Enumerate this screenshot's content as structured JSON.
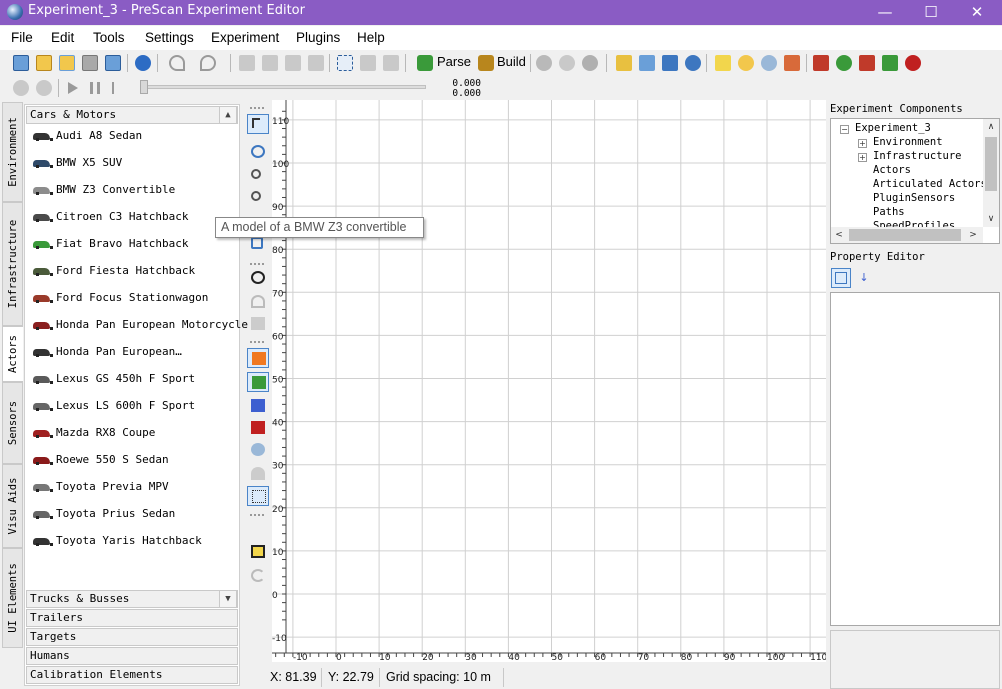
{
  "window": {
    "title": "Experiment_3 - PreScan Experiment Editor",
    "controls": {
      "minimize": "—",
      "maximize": "☐",
      "close": "✕"
    }
  },
  "menu": [
    "File",
    "Edit",
    "Tools",
    "Settings",
    "Experiment",
    "Plugins",
    "Help"
  ],
  "toolbar": {
    "parse_label": "Parse",
    "build_label": "Build"
  },
  "sim_readout": {
    "top": "0.000",
    "bottom": "0.000"
  },
  "side_tabs": [
    "Environment",
    "Infrastructure",
    "Actors",
    "Sensors",
    "Visu Aids",
    "UI Elements"
  ],
  "palette": {
    "expanded_category": "Cars & Motors",
    "items": [
      "Audi A8 Sedan",
      "BMW X5 SUV",
      "BMW Z3 Convertible",
      "Citroen C3 Hatchback",
      "Fiat Bravo Hatchback",
      "Ford Fiesta Hatchback",
      "Ford Focus Stationwagon",
      "Honda Pan European Motorcycle",
      "Honda Pan European…",
      "Lexus GS 450h F Sport",
      "Lexus LS 600h F Sport",
      "Mazda RX8 Coupe",
      "Roewe 550 S Sedan",
      "Toyota Previa MPV",
      "Toyota Prius Sedan",
      "Toyota Yaris Hatchback"
    ],
    "item_colors": [
      "#333333",
      "#2f4a6a",
      "#8c8c8c",
      "#4a4a4a",
      "#3a9a3a",
      "#4a5a3a",
      "#9a3a2a",
      "#8a1f1f",
      "#333333",
      "#5a5a5a",
      "#666666",
      "#a02020",
      "#8a1a1a",
      "#777777",
      "#666666",
      "#333333"
    ],
    "collapsed_categories": [
      "Trucks & Busses",
      "Trailers",
      "Targets",
      "Humans",
      "Calibration Elements"
    ]
  },
  "tooltip": "A model of a BMW Z3 convertible",
  "canvas": {
    "y_ticks": [
      "110",
      "100",
      "90",
      "80",
      "70",
      "60",
      "50",
      "40",
      "30",
      "20",
      "10",
      "0",
      "-10"
    ],
    "x_ticks": [
      "-10",
      "0",
      "10",
      "20",
      "30",
      "40",
      "50",
      "60",
      "70",
      "80",
      "90",
      "100",
      "110"
    ]
  },
  "status": {
    "x": "X: 81.39",
    "y": "Y: 22.79",
    "grid": "Grid spacing: 10 m"
  },
  "right_panel": {
    "components_label": "Experiment Components",
    "tree": [
      {
        "label": "Experiment_3",
        "expander": "⊟"
      },
      {
        "label": "Environment",
        "expander": "⊞"
      },
      {
        "label": "Infrastructure",
        "expander": "⊞"
      },
      {
        "label": "Actors",
        "expander": ""
      },
      {
        "label": "Articulated Actors",
        "expander": ""
      },
      {
        "label": "PluginSensors",
        "expander": ""
      },
      {
        "label": "Paths",
        "expander": ""
      },
      {
        "label": "SpeedProfiles",
        "expander": ""
      }
    ],
    "property_editor_label": "Property Editor"
  }
}
